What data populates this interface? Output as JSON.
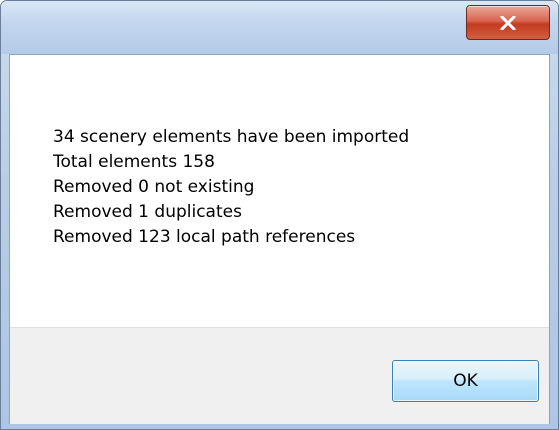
{
  "titlebar": {
    "title": "",
    "close_icon": "close-icon",
    "close_color": "#c23b22"
  },
  "message": {
    "lines": [
      "34 scenery elements have been imported",
      "Total elements 158",
      "Removed 0 not existing",
      "Removed 1 duplicates",
      "Removed 123 local path references"
    ]
  },
  "footer": {
    "ok_label": "OK"
  }
}
